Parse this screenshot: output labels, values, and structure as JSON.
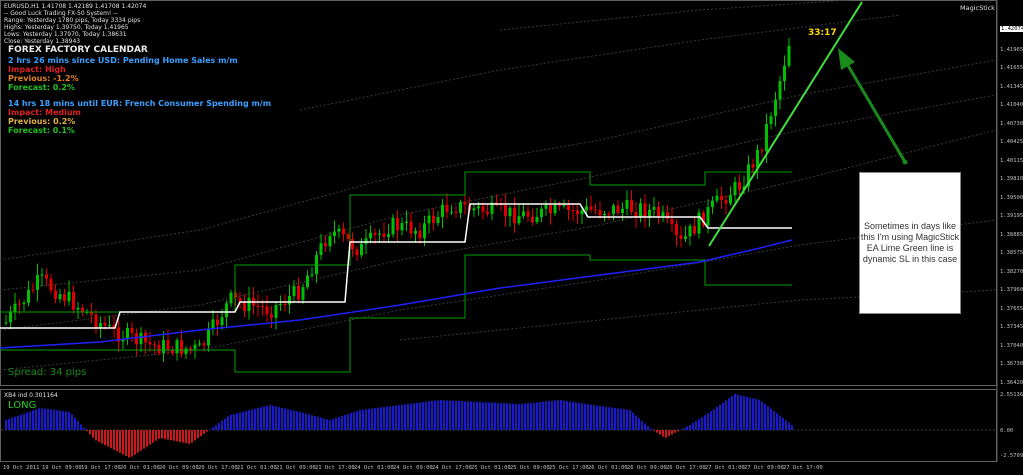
{
  "header": {
    "symbol_line": "EURUSD,H1  1.41708 1.42189 1.41708 1.42074",
    "info_lines": [
      "-- Good Luck Trading FX-50 System! --",
      "Range: Yesterday 1780 pips, Today 3334 pips",
      "Highs: Yesterday 1.39750, Today 1.41965",
      "Lows: Yesterday 1.37970, Today 1.38631",
      "Close: Yesterday 1.38943"
    ],
    "indicator_name": "MagicStick"
  },
  "calendar": {
    "title": "FOREX FACTORY CALENDAR",
    "event1": {
      "headline": "2 hrs 26 mins since USD: Pending Home Sales m/m",
      "impact": "Impact: High",
      "previous": "Previous: -1.2%",
      "forecast": "Forecast: 0.2%"
    },
    "event2": {
      "headline": "14 hrs 18 mins until EUR: French Consumer Spending m/m",
      "impact": "Impact: Medium",
      "previous": "Previous: 0.2%",
      "forecast": "Forecast: 0.1%"
    }
  },
  "countdown": "33:17",
  "spread": "Spread: 34 pips",
  "annotation_text": "Sometimes in days like this I'm using MagicStick EA Lime Green line is dynamic SL in this case",
  "price_axis": [
    "1.42274",
    "1.41965",
    "1.41655",
    "1.41345",
    "1.41040",
    "1.40730",
    "1.40425",
    "1.40115",
    "1.39810",
    "1.39500",
    "1.39195",
    "1.38885",
    "1.38575",
    "1.38270",
    "1.37960",
    "1.37655",
    "1.37345",
    "1.37040",
    "1.36730",
    "1.36420"
  ],
  "current_price": "1.42074",
  "time_axis": [
    "19 Oct 2011",
    "19 Oct 09:00",
    "19 Oct 17:00",
    "20 Oct 01:00",
    "20 Oct 09:00",
    "20 Oct 17:00",
    "21 Oct 01:00",
    "21 Oct 09:00",
    "21 Oct 17:00",
    "24 Oct 01:00",
    "24 Oct 09:00",
    "24 Oct 17:00",
    "25 Oct 01:00",
    "25 Oct 09:00",
    "25 Oct 17:00",
    "26 Oct 01:00",
    "26 Oct 09:00",
    "26 Oct 17:00",
    "27 Oct 01:00",
    "27 Oct 09:00",
    "27 Oct 17:00"
  ],
  "sub_window": {
    "title": "XB4 ind 0.301164",
    "signal": "LONG",
    "axis": [
      "2.55136",
      "0.00",
      "-2.57090"
    ]
  },
  "colors": {
    "bull": "#00c000",
    "bear": "#e00000",
    "channel": "#00a000",
    "midline": "#ffffff",
    "ma": "#2020ff",
    "trendline": "#40e040",
    "arrow": "#1a8a1a",
    "hist_pos": "#2020ff",
    "hist_neg": "#ff2020"
  }
}
